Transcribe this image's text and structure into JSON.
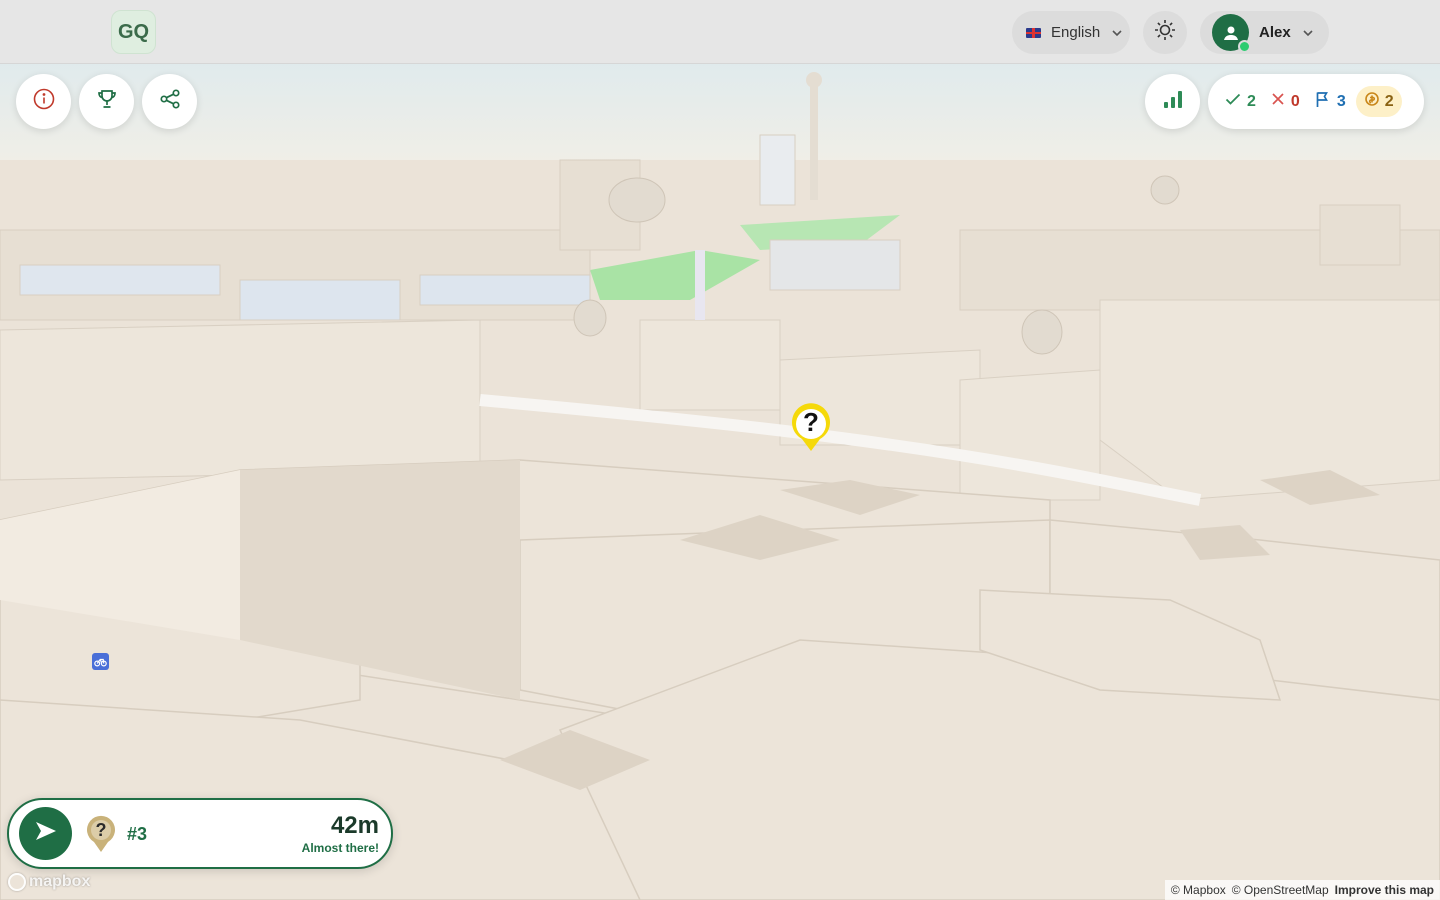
{
  "app": {
    "logo_text": "GQ"
  },
  "header": {
    "language_label": "English",
    "language_flag": "uk-flag",
    "theme_toggle_icon": "sun-icon",
    "user_name": "Alex",
    "user_status": "online"
  },
  "toolbar_left": [
    {
      "icon": "info-icon"
    },
    {
      "icon": "trophy-icon"
    },
    {
      "icon": "share-icon"
    }
  ],
  "stats": {
    "chart_icon": "bar-chart-icon",
    "correct": "2",
    "wrong": "0",
    "flags": "3",
    "coins": "2"
  },
  "target_card": {
    "number": "#3",
    "distance": "42m",
    "message": "Almost there!"
  },
  "map": {
    "quest_marker_symbol": "?",
    "provider_logo": "mapbox",
    "attribution_mapbox": "© Mapbox",
    "attribution_osm": "© OpenStreetMap",
    "attribution_improve": "Improve this map"
  },
  "colors": {
    "accent_green": "#1f6e45",
    "correct_green": "#2e8b57",
    "wrong_red": "#d9534f",
    "flag_blue": "#1f6fb2",
    "coin_gold": "#c9871a",
    "marker_yellow": "#f5d90a"
  }
}
